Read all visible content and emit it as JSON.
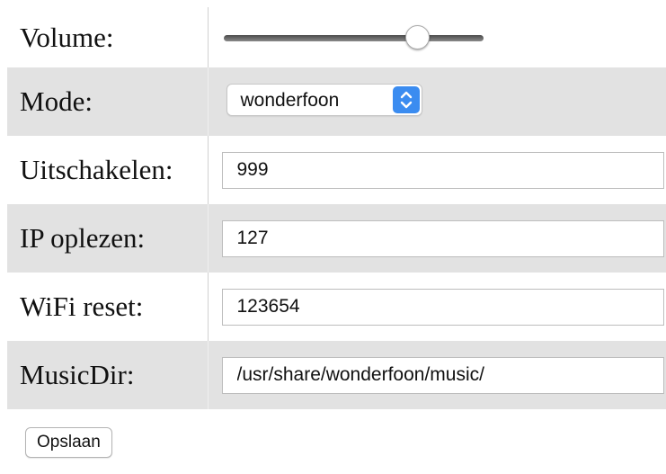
{
  "form": {
    "volume": {
      "label": "Volume:",
      "level": 0.75
    },
    "mode": {
      "label": "Mode:",
      "selected": "wonderfoon"
    },
    "uitschakelen": {
      "label": "Uitschakelen:",
      "value": "999"
    },
    "ip_oplezen": {
      "label": "IP oplezen:",
      "value": "127"
    },
    "wifi_reset": {
      "label": "WiFi reset:",
      "value": "123654"
    },
    "music_dir": {
      "label": "MusicDir:",
      "value": "/usr/share/wonderfoon/music/"
    },
    "save_label": "Opslaan"
  },
  "colors": {
    "row_gray": "#e2e2e2",
    "select_accent": "#3b8cf0"
  },
  "icons": {
    "select_arrows": "chevron-up-down-icon"
  }
}
